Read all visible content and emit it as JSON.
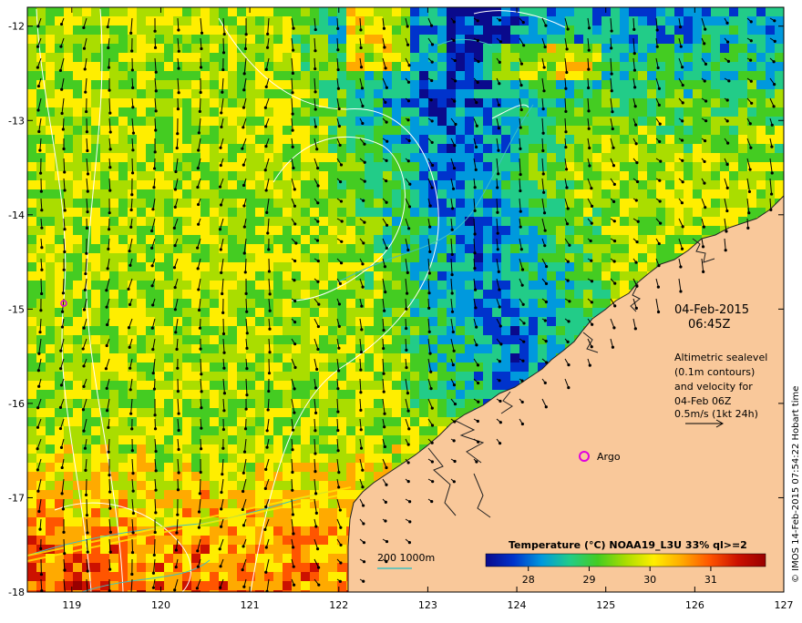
{
  "map": {
    "lon_range": [
      118.5,
      127
    ],
    "lat_range": [
      -18,
      -11.8
    ],
    "lon_ticks": [
      "119",
      "120",
      "121",
      "122",
      "123",
      "124",
      "125",
      "126",
      "127"
    ],
    "lat_ticks": [
      "-12",
      "-13",
      "-14",
      "-15",
      "-16",
      "-17",
      "-18"
    ],
    "land_color": "#f9c89a",
    "coast_color": "#222222",
    "contour_color": "#ffffff",
    "depth_contour_color": "#40c0c0",
    "arrow_color": "#000000"
  },
  "annotations": {
    "date": "04-Feb-2015",
    "time": "06:45Z",
    "altimetry_lines": [
      "Altimetric sealevel",
      "(0.1m contours)",
      "and velocity for",
      "04-Feb 06Z",
      "0.5m/s (1kt 24h)"
    ],
    "argo_label": "Argo",
    "depth_legend": "200  1000m",
    "credit": "© IMOS 14-Feb-2015 07:54:22 Hobart time"
  },
  "colorbar": {
    "title": "Temperature (°C) NOAA19_L3U 33% ql>=2",
    "range": [
      27.3,
      31.9
    ],
    "ticks": [
      "28",
      "29",
      "30",
      "31"
    ],
    "colormap": [
      "#0a0a8c",
      "#0033cc",
      "#0099dd",
      "#22cc88",
      "#44cc22",
      "#aadd00",
      "#ffee00",
      "#ffaa00",
      "#ff5500",
      "#cc1100",
      "#990000"
    ]
  }
}
